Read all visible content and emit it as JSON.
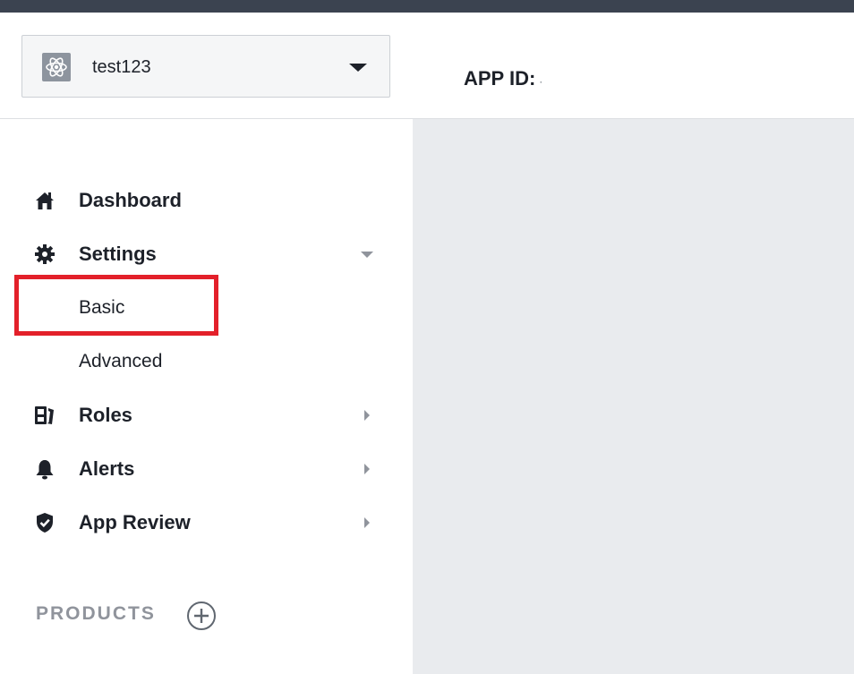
{
  "header": {
    "app_name": "test123",
    "app_id_label": "APP ID:",
    "app_id_value": "·"
  },
  "sidebar": {
    "items": [
      {
        "label": "Dashboard",
        "icon": "home-icon"
      },
      {
        "label": "Settings",
        "icon": "gear-icon",
        "expanded": true,
        "children": [
          {
            "label": "Basic",
            "highlighted": true
          },
          {
            "label": "Advanced"
          }
        ]
      },
      {
        "label": "Roles",
        "icon": "roles-icon"
      },
      {
        "label": "Alerts",
        "icon": "bell-icon"
      },
      {
        "label": "App Review",
        "icon": "shield-check-icon"
      }
    ],
    "products_label": "PRODUCTS"
  },
  "colors": {
    "top_bar": "#3b4350",
    "main_background": "#e9ebee",
    "highlight": "#e3202a",
    "muted": "#90949c"
  }
}
